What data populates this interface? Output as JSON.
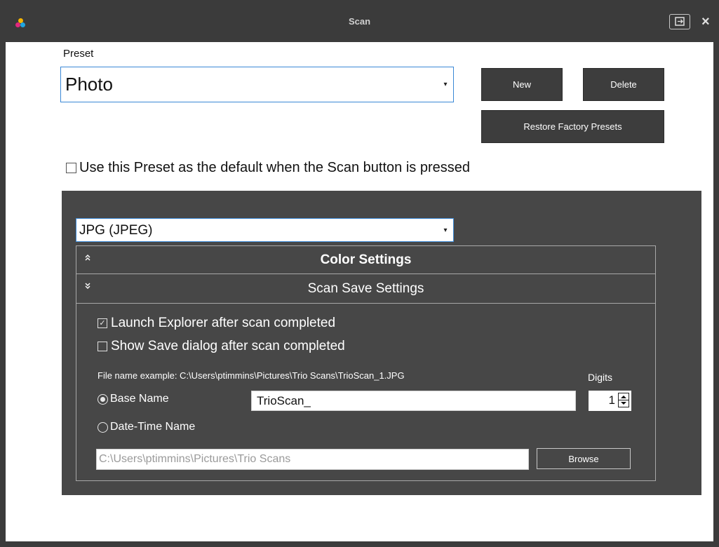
{
  "window": {
    "title": "Scan",
    "logo_colors": [
      "#f7b500",
      "#e2287c",
      "#1fa6e0"
    ]
  },
  "preset": {
    "label": "Preset",
    "value": "Photo",
    "new_button": "New",
    "delete_button": "Delete",
    "restore_button": "Restore Factory Presets",
    "default_checkbox_label": "Use this Preset as the default when the Scan button is pressed",
    "default_checked": false
  },
  "format": {
    "value": "JPG (JPEG)"
  },
  "sections": {
    "color": {
      "label": "Color Settings",
      "expanded": false
    },
    "save": {
      "label": "Scan Save Settings",
      "expanded": true
    }
  },
  "save_settings": {
    "launch_explorer_label": "Launch Explorer after scan completed",
    "launch_explorer_checked": true,
    "show_save_dialog_label": "Show Save dialog after scan completed",
    "show_save_dialog_checked": false,
    "file_name_example": "File name example:  C:\\Users\\ptimmins\\Pictures\\Trio Scans\\TrioScan_1.JPG",
    "digits_label": "Digits",
    "digits_value": "1",
    "base_name_label": "Base Name",
    "base_name_selected": true,
    "base_name_value": "TrioScan_",
    "date_time_label": "Date-Time Name",
    "folder_path": "C:\\Users\\ptimmins\\Pictures\\Trio Scans",
    "browse_button": "Browse"
  }
}
